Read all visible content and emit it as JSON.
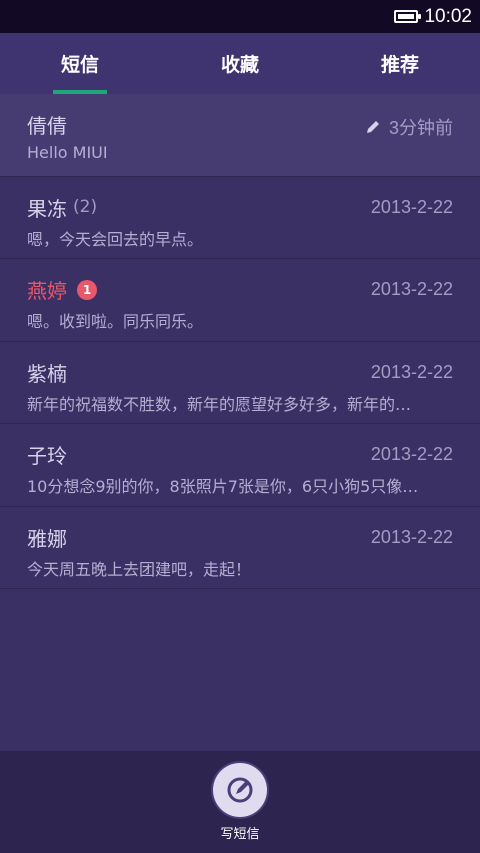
{
  "status_bar": {
    "time": "10:02"
  },
  "tabs": [
    {
      "label": "短信",
      "active": true
    },
    {
      "label": "收藏",
      "active": false
    },
    {
      "label": "推荐",
      "active": false
    }
  ],
  "messages": [
    {
      "name": "倩倩",
      "count": "",
      "badge": "",
      "time": "3分钟前",
      "preview": "Hello MIUI",
      "draft": true,
      "unread": false
    },
    {
      "name": "果冻",
      "count": "(2)",
      "badge": "",
      "time": "2013-2-22",
      "preview": "嗯，今天会回去的早点。",
      "draft": false,
      "unread": false
    },
    {
      "name": "燕婷",
      "count": "",
      "badge": "1",
      "time": "2013-2-22",
      "preview": "嗯。收到啦。同乐同乐。",
      "draft": false,
      "unread": true
    },
    {
      "name": "紫楠",
      "count": "",
      "badge": "",
      "time": "2013-2-22",
      "preview": "新年的祝福数不胜数，新年的愿望好多好多，新年的…",
      "draft": false,
      "unread": false
    },
    {
      "name": "子玲",
      "count": "",
      "badge": "",
      "time": "2013-2-22",
      "preview": "10分想念9别的你，8张照片7张是你，6只小狗5只像…",
      "draft": false,
      "unread": false
    },
    {
      "name": "雅娜",
      "count": "",
      "badge": "",
      "time": "2013-2-22",
      "preview": "今天周五晚上去团建吧，走起！",
      "draft": false,
      "unread": false
    }
  ],
  "compose": {
    "label": "写短信",
    "icon": "compose-icon"
  },
  "colors": {
    "accent": "#1ea87a",
    "unread": "#e9576a",
    "background": "#3a3064"
  }
}
